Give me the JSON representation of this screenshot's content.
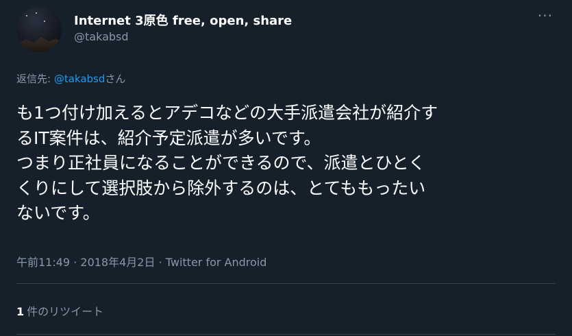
{
  "user": {
    "display_name": "Internet 3原色 free, open, share",
    "handle": "@takabsd"
  },
  "reply_to": {
    "prefix": "返信先: ",
    "mention": "@takabsd",
    "suffix": "さん"
  },
  "tweet": {
    "lines": [
      "も1つ付け加えるとアデコなどの大手派遣会社が紹介す",
      "るIT案件は、紹介予定派遣が多いです。",
      "つまり正社員になることができるので、派遣とひとく",
      "くりにして選択肢から除外するのは、とてももったい",
      "ないです。"
    ]
  },
  "meta": {
    "time": "午前11:49",
    "separator": " · ",
    "date": "2018年4月2日",
    "separator2": " · ",
    "source": "Twitter for Android"
  },
  "stats": {
    "retweet_count": "1",
    "retweet_label": "件のリツイート"
  },
  "icons": {
    "more": "more-horizontal-icon"
  },
  "colors": {
    "background": "#15202b",
    "text": "#ffffff",
    "secondary": "#8899a6",
    "link": "#1d9bf0",
    "divider": "#38444d"
  }
}
